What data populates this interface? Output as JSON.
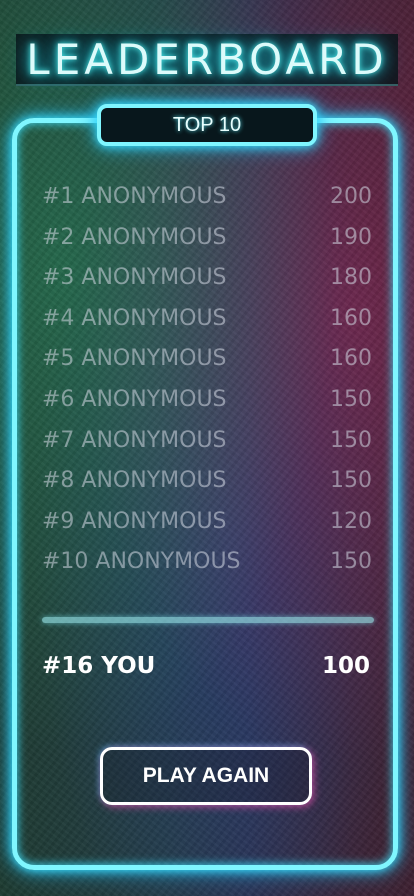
{
  "header": {
    "title": "LEADERBOARD",
    "tab_label": "TOP 10"
  },
  "leaderboard": {
    "rows": [
      {
        "rank": "#1 ANONYMOUS",
        "score": "200"
      },
      {
        "rank": "#2 ANONYMOUS",
        "score": "190"
      },
      {
        "rank": "#3 ANONYMOUS",
        "score": "180"
      },
      {
        "rank": "#4 ANONYMOUS",
        "score": "160"
      },
      {
        "rank": "#5 ANONYMOUS",
        "score": "160"
      },
      {
        "rank": "#6 ANONYMOUS",
        "score": "150"
      },
      {
        "rank": "#7 ANONYMOUS",
        "score": "150"
      },
      {
        "rank": "#8 ANONYMOUS",
        "score": "150"
      },
      {
        "rank": "#9 ANONYMOUS",
        "score": "120"
      },
      {
        "rank": "#10 ANONYMOUS",
        "score": "150"
      }
    ],
    "you": {
      "rank": "#16 YOU",
      "score": "100"
    }
  },
  "actions": {
    "play_again_label": "PLAY AGAIN"
  },
  "colors": {
    "neon_frame": "#7ff6ff",
    "neon_glow": "#20b6ef",
    "button_glow": "#ff50b4"
  }
}
